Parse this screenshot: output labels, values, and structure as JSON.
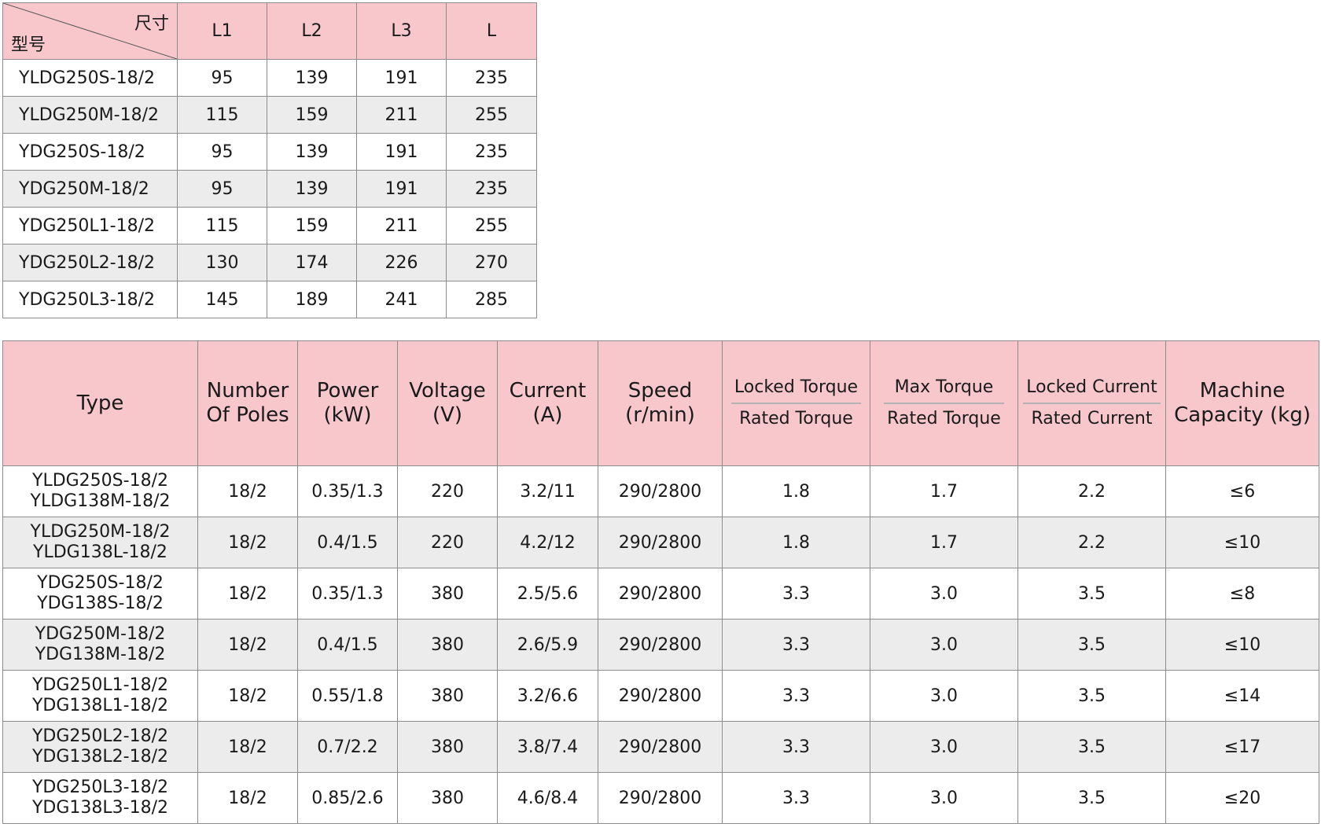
{
  "dimension_table": {
    "corner_top_label": "尺寸",
    "corner_bottom_label": "型号",
    "columns": [
      "L1",
      "L2",
      "L3",
      "L"
    ],
    "rows": [
      {
        "model": "YLDG250S-18/2",
        "values": [
          "95",
          "139",
          "191",
          "235"
        ]
      },
      {
        "model": "YLDG250M-18/2",
        "values": [
          "115",
          "159",
          "211",
          "255"
        ]
      },
      {
        "model": "YDG250S-18/2",
        "values": [
          "95",
          "139",
          "191",
          "235"
        ]
      },
      {
        "model": "YDG250M-18/2",
        "values": [
          "95",
          "139",
          "191",
          "235"
        ]
      },
      {
        "model": "YDG250L1-18/2",
        "values": [
          "115",
          "159",
          "211",
          "255"
        ]
      },
      {
        "model": "YDG250L2-18/2",
        "values": [
          "130",
          "174",
          "226",
          "270"
        ]
      },
      {
        "model": "YDG250L3-18/2",
        "values": [
          "145",
          "189",
          "241",
          "285"
        ]
      }
    ]
  },
  "performance_table": {
    "headers": {
      "type": "Type",
      "poles": "Number Of Poles",
      "power": "Power (kW)",
      "voltage": "Voltage (V)",
      "current": "Current (A)",
      "speed": "Speed (r/min)",
      "locked_torque": {
        "numerator": "Locked Torque",
        "denominator": "Rated Torque"
      },
      "max_torque": {
        "numerator": "Max Torque",
        "denominator": "Rated Torque"
      },
      "locked_current": {
        "numerator": "Locked Current",
        "denominator": "Rated Current"
      },
      "capacity": "Machine Capacity (kg)"
    },
    "rows": [
      {
        "type1": "YLDG250S-18/2",
        "type2": "YLDG138M-18/2",
        "poles": "18/2",
        "power": "0.35/1.3",
        "voltage": "220",
        "current": "3.2/11",
        "speed": "290/2800",
        "locked_torque": "1.8",
        "max_torque": "1.7",
        "locked_current": "2.2",
        "capacity": "≤6"
      },
      {
        "type1": "YLDG250M-18/2",
        "type2": "YLDG138L-18/2",
        "poles": "18/2",
        "power": "0.4/1.5",
        "voltage": "220",
        "current": "4.2/12",
        "speed": "290/2800",
        "locked_torque": "1.8",
        "max_torque": "1.7",
        "locked_current": "2.2",
        "capacity": "≤10"
      },
      {
        "type1": "YDG250S-18/2",
        "type2": "YDG138S-18/2",
        "poles": "18/2",
        "power": "0.35/1.3",
        "voltage": "380",
        "current": "2.5/5.6",
        "speed": "290/2800",
        "locked_torque": "3.3",
        "max_torque": "3.0",
        "locked_current": "3.5",
        "capacity": "≤8"
      },
      {
        "type1": "YDG250M-18/2",
        "type2": "YDG138M-18/2",
        "poles": "18/2",
        "power": "0.4/1.5",
        "voltage": "380",
        "current": "2.6/5.9",
        "speed": "290/2800",
        "locked_torque": "3.3",
        "max_torque": "3.0",
        "locked_current": "3.5",
        "capacity": "≤10"
      },
      {
        "type1": "YDG250L1-18/2",
        "type2": "YDG138L1-18/2",
        "poles": "18/2",
        "power": "0.55/1.8",
        "voltage": "380",
        "current": "3.2/6.6",
        "speed": "290/2800",
        "locked_torque": "3.3",
        "max_torque": "3.0",
        "locked_current": "3.5",
        "capacity": "≤14"
      },
      {
        "type1": "YDG250L2-18/2",
        "type2": "YDG138L2-18/2",
        "poles": "18/2",
        "power": "0.7/2.2",
        "voltage": "380",
        "current": "3.8/7.4",
        "speed": "290/2800",
        "locked_torque": "3.3",
        "max_torque": "3.0",
        "locked_current": "3.5",
        "capacity": "≤17"
      },
      {
        "type1": "YDG250L3-18/2",
        "type2": "YDG138L3-18/2",
        "poles": "18/2",
        "power": "0.85/2.6",
        "voltage": "380",
        "current": "4.6/8.4",
        "speed": "290/2800",
        "locked_torque": "3.3",
        "max_torque": "3.0",
        "locked_current": "3.5",
        "capacity": "≤20"
      }
    ]
  },
  "colors": {
    "header_background": "#f7c7cc",
    "striped_row_background": "#ececec",
    "border": "#8c8c8c"
  }
}
